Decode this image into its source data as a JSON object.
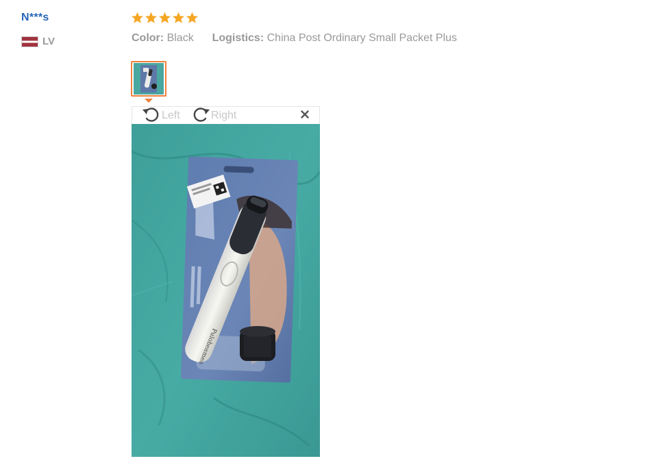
{
  "review": {
    "buyer": {
      "name": "N***s",
      "country_code": "LV",
      "flag": "latvia-flag"
    },
    "rating": {
      "stars": 5,
      "max": 5,
      "star_color": "#f5a623"
    },
    "attributes": {
      "color_label": "Color:",
      "color_value": "Black",
      "logistics_label": "Logistics:",
      "logistics_value": "China Post Ordinary Small Packet Plus"
    },
    "photos": {
      "selected_index": 0,
      "thumbnail_border_color": "#f0803c"
    },
    "viewer": {
      "rotate_left_label": "Left",
      "rotate_right_label": "Right",
      "close_icon": "close-icon",
      "rotate_left_icon": "rotate-left-icon",
      "rotate_right_icon": "rotate-right-icon"
    }
  }
}
